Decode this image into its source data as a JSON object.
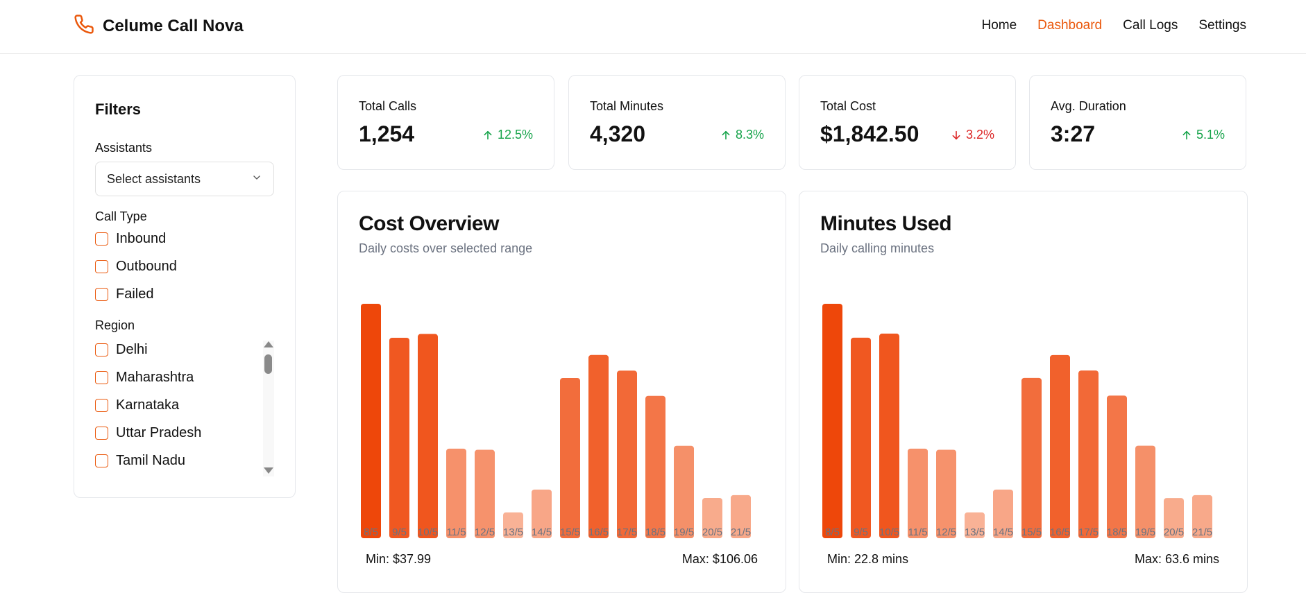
{
  "app": {
    "name": "Celume Call Nova"
  },
  "nav": {
    "items": [
      "Home",
      "Dashboard",
      "Call Logs",
      "Settings"
    ],
    "active": "Dashboard"
  },
  "filters": {
    "title": "Filters",
    "assistants_label": "Assistants",
    "assistants_placeholder": "Select assistants",
    "call_type_label": "Call Type",
    "call_types": [
      "Inbound",
      "Outbound",
      "Failed"
    ],
    "region_label": "Region",
    "regions": [
      "Delhi",
      "Maharashtra",
      "Karnataka",
      "Uttar Pradesh",
      "Tamil Nadu"
    ]
  },
  "stats": [
    {
      "label": "Total Calls",
      "value": "1,254",
      "delta": "12.5%",
      "direction": "up"
    },
    {
      "label": "Total Minutes",
      "value": "4,320",
      "delta": "8.3%",
      "direction": "up"
    },
    {
      "label": "Total Cost",
      "value": "$1,842.50",
      "delta": "3.2%",
      "direction": "down"
    },
    {
      "label": "Avg. Duration",
      "value": "3:27",
      "delta": "5.1%",
      "direction": "up"
    }
  ],
  "colors": {
    "accent": "#ea580c",
    "up": "#16a34a",
    "down": "#dc2626"
  },
  "cost_chart": {
    "title": "Cost Overview",
    "subtitle": "Daily costs over selected range",
    "min_label": "Min: $37.99",
    "max_label": "Max: $106.06"
  },
  "minutes_chart": {
    "title": "Minutes Used",
    "subtitle": "Daily calling minutes",
    "min_label": "Min: 22.8 mins",
    "max_label": "Max: 63.6 mins"
  },
  "chart_data": [
    {
      "type": "bar",
      "title": "Cost Overview",
      "categories": [
        "8/5",
        "9/5",
        "10/5",
        "11/5",
        "12/5",
        "13/5",
        "14/5",
        "15/5",
        "16/5",
        "17/5",
        "18/5",
        "19/5",
        "20/5",
        "21/5"
      ],
      "values": [
        106.06,
        90.7,
        92.4,
        40.5,
        40.0,
        11.7,
        22.0,
        72.5,
        82.9,
        75.8,
        64.4,
        41.8,
        18.2,
        19.5
      ],
      "ylim": [
        0,
        106.06
      ]
    },
    {
      "type": "bar",
      "title": "Minutes Used",
      "categories": [
        "8/5",
        "9/5",
        "10/5",
        "11/5",
        "12/5",
        "13/5",
        "14/5",
        "15/5",
        "16/5",
        "17/5",
        "18/5",
        "19/5",
        "20/5",
        "21/5"
      ],
      "values": [
        63.6,
        54.4,
        55.5,
        24.3,
        24.0,
        7.0,
        13.2,
        43.5,
        49.7,
        45.5,
        38.7,
        25.1,
        10.9,
        11.7
      ],
      "ylim": [
        0,
        63.6
      ]
    }
  ]
}
